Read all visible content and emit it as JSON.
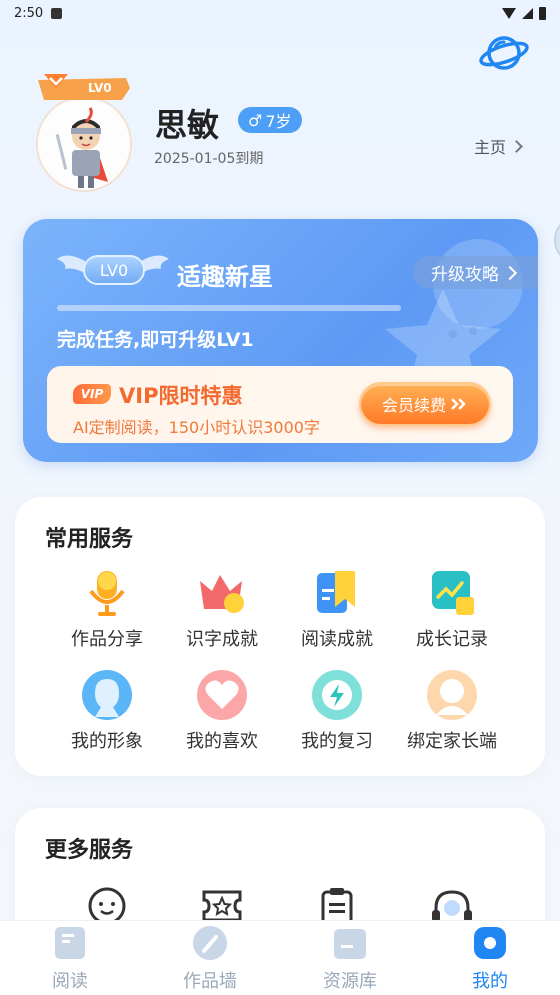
{
  "status_bar": {
    "time": "2:50"
  },
  "profile": {
    "name": "思敏",
    "age": "7岁",
    "gender_symbol": "♂",
    "expire_text": "2025-01-05到期",
    "level_badge": "LV0",
    "homepage_label": "主页"
  },
  "level_card": {
    "badge": "LV0",
    "title": "适趣新星",
    "upgrade_guide": "升级攻略",
    "progress": 0.0,
    "description": "完成任务,即可升级LV1",
    "vip": {
      "tag": "VIP",
      "title": "VIP限时特惠",
      "subtitle": "AI定制阅读，150小时认识3000字",
      "button": "会员续费"
    }
  },
  "common_services": {
    "title": "常用服务",
    "items": [
      {
        "label": "作品分享",
        "icon": "microphone-icon"
      },
      {
        "label": "识字成就",
        "icon": "crown-icon"
      },
      {
        "label": "阅读成就",
        "icon": "bookmark-icon"
      },
      {
        "label": "成长记录",
        "icon": "growth-chart-icon"
      },
      {
        "label": "我的形象",
        "icon": "avatar-icon"
      },
      {
        "label": "我的喜欢",
        "icon": "heart-icon"
      },
      {
        "label": "我的复习",
        "icon": "lightning-icon"
      },
      {
        "label": "绑定家长端",
        "icon": "parent-icon"
      }
    ]
  },
  "more_services": {
    "title": "更多服务",
    "items": [
      {
        "icon": "smile-face-icon"
      },
      {
        "icon": "ticket-star-icon"
      },
      {
        "icon": "clipboard-icon"
      },
      {
        "icon": "headset-icon"
      }
    ]
  },
  "tab_bar": {
    "tabs": [
      {
        "label": "阅读",
        "icon": "book-icon"
      },
      {
        "label": "作品墙",
        "icon": "brush-icon"
      },
      {
        "label": "资源库",
        "icon": "folder-icon"
      },
      {
        "label": "我的",
        "icon": "profile-icon"
      }
    ],
    "active_index": 3
  },
  "colors": {
    "accent": "#1f86f2",
    "level_card": "#5e9af5",
    "vip_orange": "#f26a2f"
  }
}
